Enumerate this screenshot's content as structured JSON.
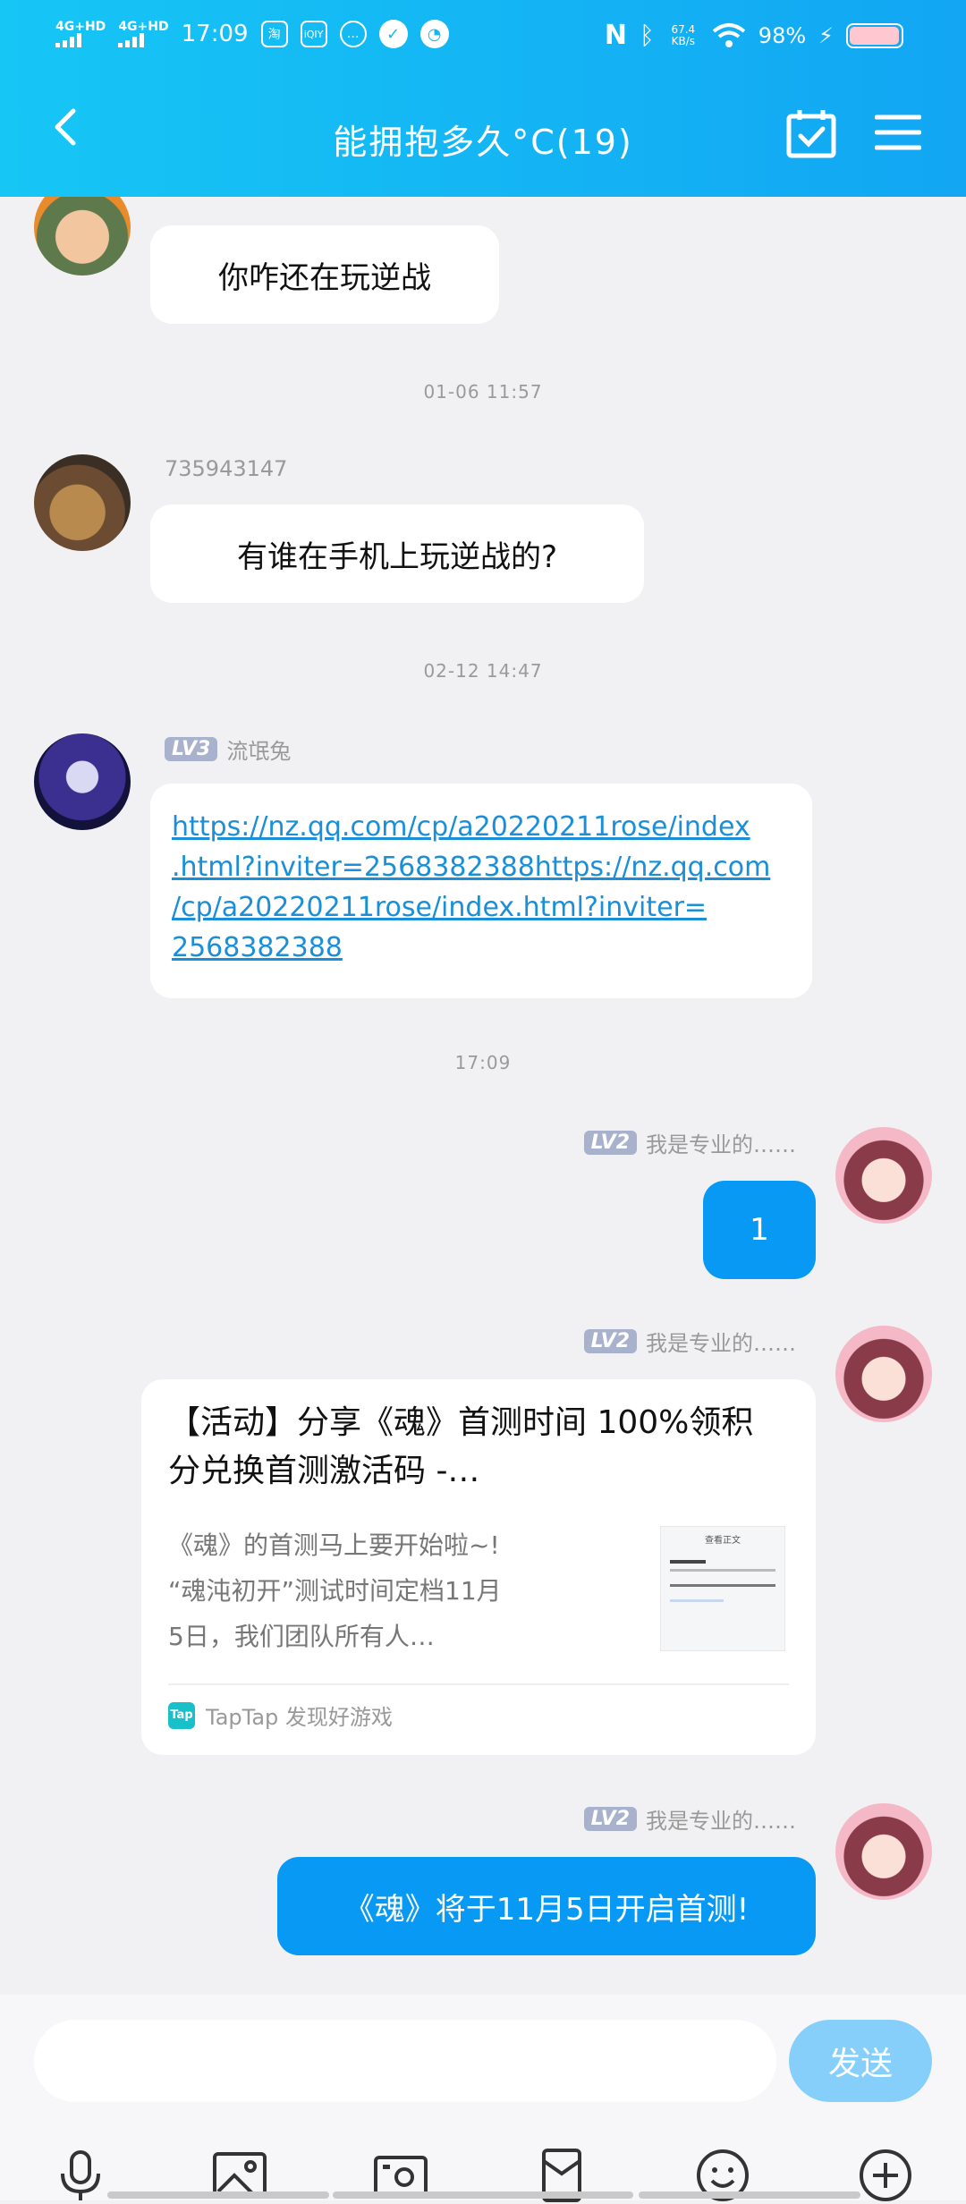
{
  "status_bar": {
    "time": "17:09",
    "signal_1": "4G+HD",
    "signal_2": "4G+HD",
    "app_icon_1": "淘",
    "app_icon_2": "iQIY",
    "network_speed": "67.4 KB/s",
    "battery": "98%",
    "battery_level": 0.98
  },
  "header": {
    "title": "能拥抱多久°C(19)"
  },
  "messages": {
    "m1": {
      "text": "你咋还在玩逆战"
    },
    "t1": "01-06 11:57",
    "m2": {
      "sender": "735943147",
      "text": "有谁在手机上玩逆战的?"
    },
    "t2": "02-12 14:47",
    "m3": {
      "level": "LV3",
      "sender": "流氓兔",
      "lines": [
        "https://nz.qq.com/cp/a20220211rose/index",
        ".html?inviter=2568382388https://nz.qq.com",
        "/cp/a20220211rose/index.html?inviter=",
        "2568382388"
      ]
    },
    "t3": "17:09",
    "m4": {
      "level": "LV2",
      "sender": "我是专业的……",
      "text": "1"
    },
    "m5": {
      "level": "LV2",
      "sender": "我是专业的……",
      "title_lines": [
        "【活动】分享《魂》首测时间 100%领积",
        "分兑换首测激活码 -…"
      ],
      "desc_lines": [
        "《魂》的首测马上要开始啦~!",
        "“魂沌初开”测试时间定档11月",
        "5日，我们团队所有人…"
      ],
      "source": "TapTap 发现好游戏",
      "source_badge": "Tap",
      "thumb_header": "查看正文"
    },
    "m6": {
      "level": "LV2",
      "sender": "我是专业的……",
      "text": "《魂》将于11月5日开启首测!"
    }
  },
  "input": {
    "placeholder": "",
    "send_label": "发送"
  },
  "colors": {
    "header_start": "#16c6f5",
    "header_end": "#12a6f3",
    "my_bubble": "#0899f5",
    "link": "#1a8fd8",
    "send_button": "#86cffb"
  },
  "icons": [
    "back-arrow-icon",
    "calendar-check-icon",
    "menu-icon",
    "microphone-icon",
    "image-icon",
    "camera-icon",
    "red-packet-icon",
    "emoji-icon",
    "plus-icon"
  ]
}
